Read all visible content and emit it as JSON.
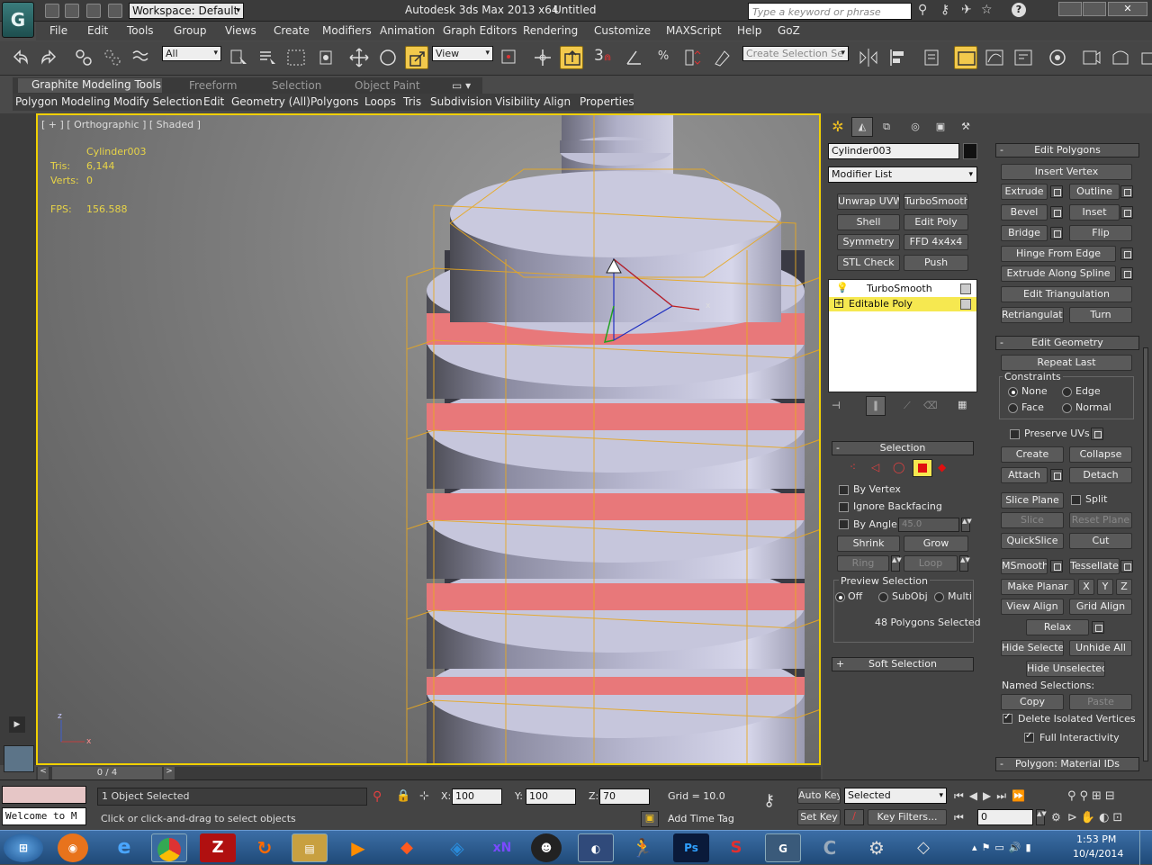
{
  "titlebar": {
    "app_title": "Autodesk 3ds Max 2013 x64",
    "doc_title": "Untitled",
    "workspace": "Workspace: Default",
    "search_placeholder": "Type a keyword or phrase",
    "logo_glyph": "G"
  },
  "menu": [
    "File",
    "Edit",
    "Tools",
    "Group",
    "Views",
    "Create",
    "Modifiers",
    "Animation",
    "Graph Editors",
    "Rendering",
    "Customize",
    "MAXScript",
    "Help",
    "GoZ"
  ],
  "toolbar": {
    "filter": "All",
    "refcoord": "View",
    "snap_num": "3",
    "selection_set_placeholder": "Create Selection Se"
  },
  "ribbon": {
    "tabs": [
      "Graphite Modeling Tools",
      "Freeform",
      "Selection",
      "Object Paint"
    ],
    "panels": [
      "Polygon Modeling",
      "Modify Selection",
      "Edit",
      "Geometry (All)",
      "Polygons",
      "Loops",
      "Tris",
      "Subdivision",
      "Visibility",
      "Align",
      "Properties"
    ]
  },
  "viewport": {
    "label": "[ + ] [ Orthographic ] [ Shaded ]",
    "object": "Cylinder003",
    "tris_label": "Tris:",
    "tris_value": "6,144",
    "verts_label": "Verts:",
    "verts_value": "0",
    "fps_label": "FPS:",
    "fps_value": "156.588",
    "axis_x": "x",
    "axis_z": "z"
  },
  "timeslider": {
    "position": "0 / 4"
  },
  "command_panel": {
    "object_name": "Cylinder003",
    "modifier_list": "Modifier List",
    "modifier_buttons": [
      "Unwrap UVW",
      "TurboSmooth",
      "Shell",
      "Edit Poly",
      "Symmetry",
      "FFD 4x4x4",
      "STL Check",
      "Push"
    ],
    "stack": [
      "TurboSmooth",
      "Editable Poly"
    ],
    "selection_header": "Selection",
    "by_vertex": "By Vertex",
    "ignore_backfacing": "Ignore Backfacing",
    "by_angle": "By Angle:",
    "angle_value": "45.0",
    "shrink": "Shrink",
    "grow": "Grow",
    "ring": "Ring",
    "loop": "Loop",
    "preview_selection": "Preview Selection",
    "preview_off": "Off",
    "preview_subobj": "SubObj",
    "preview_multi": "Multi",
    "selected_count": "48 Polygons Selected",
    "soft_selection": "Soft Selection"
  },
  "edit_polygons": {
    "header": "Edit Polygons",
    "insert_vertex": "Insert Vertex",
    "extrude": "Extrude",
    "outline": "Outline",
    "bevel": "Bevel",
    "inset": "Inset",
    "bridge": "Bridge",
    "flip": "Flip",
    "hinge": "Hinge From Edge",
    "extrude_spline": "Extrude Along Spline",
    "edit_triangulation": "Edit Triangulation",
    "retriangulate": "Retriangulate",
    "turn": "Turn"
  },
  "edit_geometry": {
    "header": "Edit Geometry",
    "repeat_last": "Repeat Last",
    "constraints": "Constraints",
    "none": "None",
    "edge": "Edge",
    "face": "Face",
    "normal": "Normal",
    "preserve_uvs": "Preserve UVs",
    "create": "Create",
    "collapse": "Collapse",
    "attach": "Attach",
    "detach": "Detach",
    "slice_plane": "Slice Plane",
    "split": "Split",
    "slice": "Slice",
    "reset_plane": "Reset Plane",
    "quickslice": "QuickSlice",
    "cut": "Cut",
    "msmooth": "MSmooth",
    "tessellate": "Tessellate",
    "make_planar": "Make Planar",
    "x": "X",
    "y": "Y",
    "z": "Z",
    "view_align": "View Align",
    "grid_align": "Grid Align",
    "relax": "Relax",
    "hide_selected": "Hide Selected",
    "unhide_all": "Unhide All",
    "hide_unselected": "Hide Unselected",
    "named_selections": "Named Selections:",
    "copy": "Copy",
    "paste": "Paste",
    "delete_isolated": "Delete Isolated Vertices",
    "full_interactivity": "Full Interactivity",
    "material_ids": "Polygon: Material IDs"
  },
  "status": {
    "maxscript": "Welcome to M",
    "selected": "1 Object Selected",
    "prompt": "Click or click-and-drag to select objects",
    "x_label": "X:",
    "x": "100",
    "y_label": "Y:",
    "y": "100",
    "z_label": "Z:",
    "z": "70",
    "grid": "Grid = 10.0",
    "add_time_tag": "Add Time Tag",
    "auto_key": "Auto Key",
    "set_key": "Set Key",
    "key_mode": "Selected",
    "key_filters": "Key Filters...",
    "frame": "0"
  },
  "taskbar": {
    "time": "1:53 PM",
    "date": "10/4/2014"
  },
  "colors": {
    "selection_red": "#e8787a",
    "viewport_border": "#f0d000",
    "cage_orange": "#e8a820"
  }
}
